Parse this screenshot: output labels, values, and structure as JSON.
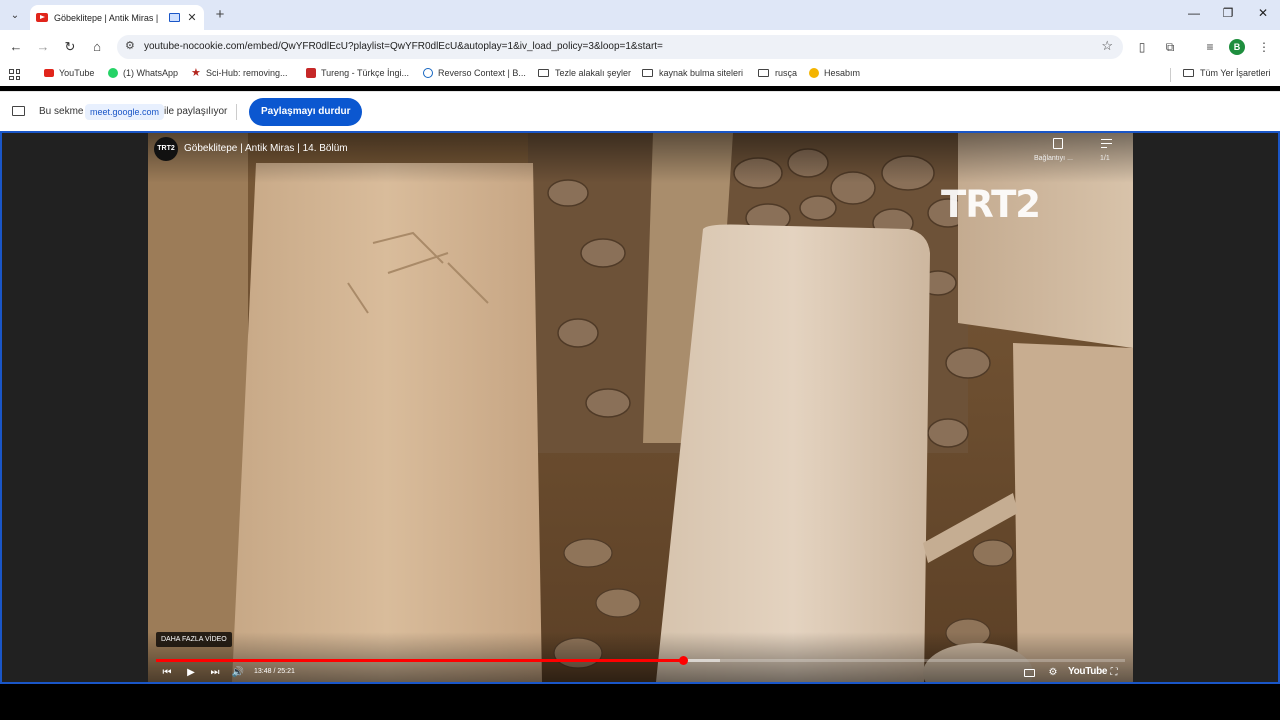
{
  "tabs": [
    {
      "title": "Göbeklitepe | Antik Miras |"
    }
  ],
  "toolbar": {
    "url": "youtube-nocookie.com/embed/QwYFR0dlEcU?playlist=QwYFR0dlEcU&autoplay=1&iv_load_policy=3&loop=1&start=",
    "profile_initial": "B"
  },
  "bookmarks": {
    "items": [
      {
        "label": "YouTube",
        "icon": "youtube-icon",
        "color": "#e1251b"
      },
      {
        "label": "(1) WhatsApp",
        "icon": "whatsapp-icon",
        "color": "#25d366"
      },
      {
        "label": "Sci-Hub: removing...",
        "icon": "scihub-icon",
        "color": "#b3261e"
      },
      {
        "label": "Tureng - Türkçe İngi...",
        "icon": "tureng-icon",
        "color": "#c62828"
      },
      {
        "label": "Reverso Context | B...",
        "icon": "reverso-icon",
        "color": "#1565c0"
      },
      {
        "label": "Tezle alakalı şeyler",
        "icon": "folder-icon"
      },
      {
        "label": "kaynak bulma siteleri",
        "icon": "folder-icon"
      },
      {
        "label": "rusça",
        "icon": "folder-icon"
      },
      {
        "label": "Hesabım",
        "icon": "account-icon",
        "color": "#f4b400"
      }
    ],
    "all_bookmarks": "Tüm Yer İşaretleri"
  },
  "sharebar": {
    "text_before": "Bu sekme",
    "domain": "meet.google.com",
    "text_after": "ile paylaşılıyor",
    "stop_button": "Paylaşmayı durdur"
  },
  "player": {
    "channel_logo": "TRT2",
    "title": "Göbeklitepe | Antik Miras | 14. Bölüm",
    "copy_link_label": "Bağlantıyı ...",
    "playlist_position": "1/1",
    "watermark": "TRT2",
    "more_videos": "DAHA FAZLA VİDEO",
    "current_time": "13:48",
    "duration": "25:21",
    "time_display": "13:48 / 25:21",
    "progress_fraction": 0.544,
    "buffered_fraction": 0.582,
    "youtube_logo": "YouTube"
  },
  "colors": {
    "accent": "#0b57d0",
    "progress": "#ff0000",
    "share_border": "#1a56c7"
  }
}
